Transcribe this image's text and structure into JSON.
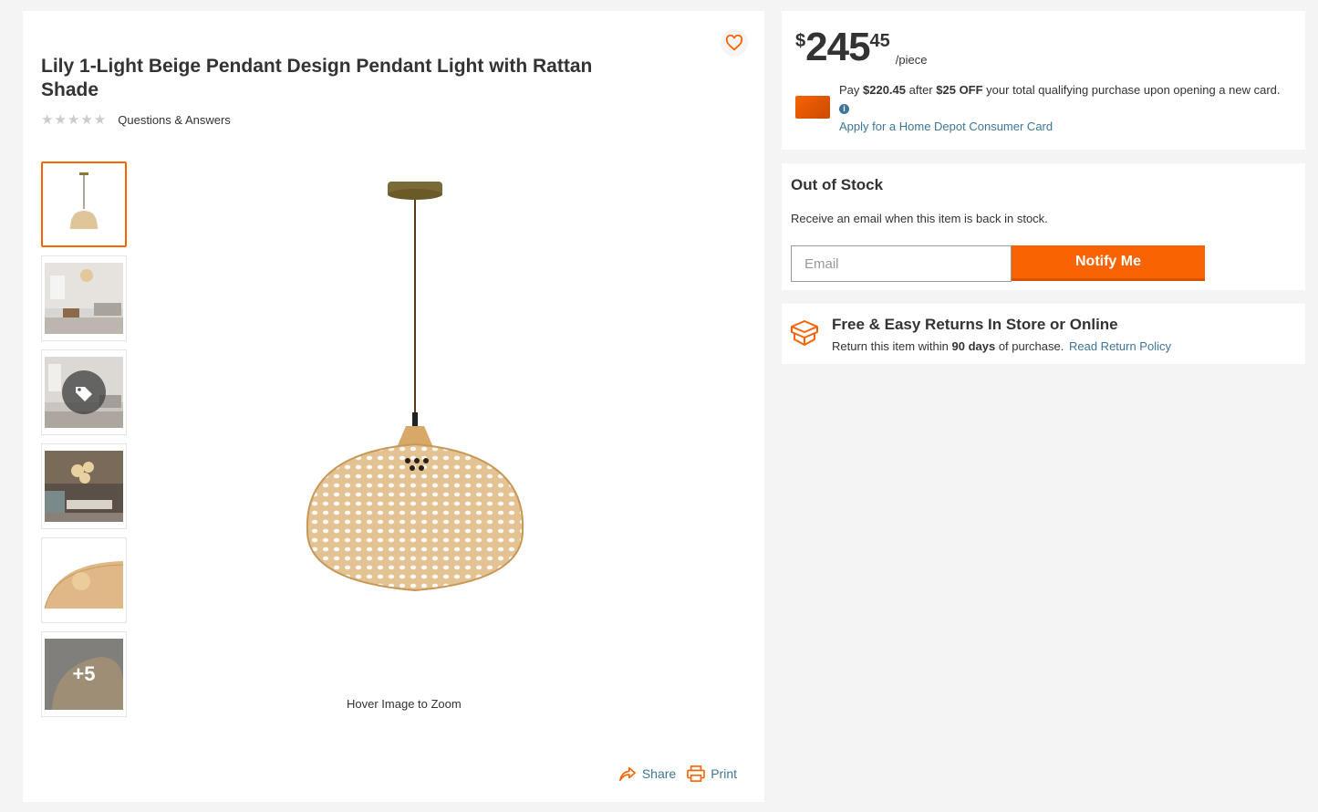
{
  "product": {
    "title": "Lily 1-Light Beige Pendant Design Pendant Light with Rattan Shade",
    "rating_stars": "★★★★★",
    "qa_link": "Questions & Answers",
    "favorite_icon": "heart-icon"
  },
  "gallery": {
    "thumbnails": [
      {
        "kind": "pendant-product"
      },
      {
        "kind": "living-room"
      },
      {
        "kind": "living-room-tag"
      },
      {
        "kind": "dining-room"
      },
      {
        "kind": "shade-closeup"
      },
      {
        "kind": "more",
        "label": "+5"
      }
    ],
    "zoom_hint": "Hover Image to Zoom"
  },
  "actions": {
    "share_label": "Share",
    "print_label": "Print"
  },
  "pricing": {
    "currency": "$",
    "dollars": "245",
    "cents": "45",
    "unit": "/piece",
    "promo_prefix": "Pay ",
    "promo_price": "$220.45",
    "promo_mid": " after ",
    "promo_off": "$25 OFF",
    "promo_suffix": " your total qualifying purchase upon opening a new card. ",
    "apply_link": "Apply for a Home Depot Consumer Card"
  },
  "stock": {
    "title": "Out of Stock",
    "message": "Receive an email when this item is back in stock.",
    "email_placeholder": "Email",
    "notify_label": "Notify Me"
  },
  "returns": {
    "title": "Free & Easy Returns In Store or Online",
    "text_prefix": "Return this item within ",
    "days": "90 days",
    "text_suffix": " of purchase.",
    "link": "Read Return Policy"
  },
  "colors": {
    "brand_orange": "#f96302",
    "link_blue": "#3e7697"
  }
}
